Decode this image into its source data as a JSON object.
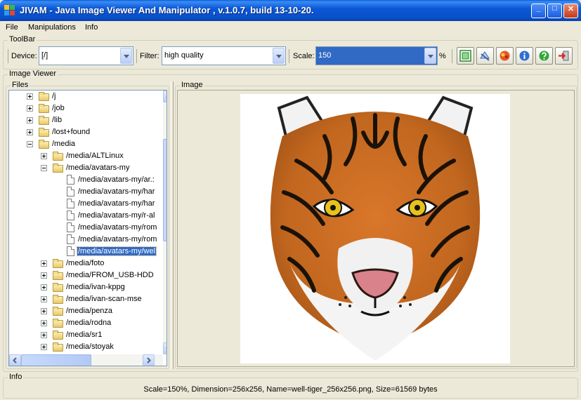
{
  "window": {
    "title": "JIVAM - Java Image Viewer And Manipulator , v.1.0.7, build 13-10-20.",
    "min_label": "_",
    "max_label": "□",
    "close_label": "✕"
  },
  "menu": {
    "items": [
      {
        "label": "File"
      },
      {
        "label": "Manipulations"
      },
      {
        "label": "Info"
      }
    ]
  },
  "toolbar": {
    "title": "ToolBar",
    "device_label": "Device:",
    "device_value": "[/]",
    "filter_label": "Filter:",
    "filter_value": "high quality",
    "scale_label": "Scale:",
    "scale_value": "150",
    "scale_unit": "%",
    "buttons": [
      {
        "icon": "fit-screen-icon"
      },
      {
        "icon": "rotate-icon"
      },
      {
        "icon": "palette-icon"
      },
      {
        "icon": "info-icon"
      },
      {
        "icon": "help-icon"
      },
      {
        "icon": "exit-icon"
      }
    ]
  },
  "viewer": {
    "title": "Image Viewer",
    "files_title": "Files",
    "image_title": "Image"
  },
  "tree": {
    "rows": [
      {
        "label": "/j",
        "type": "folder",
        "level": 0,
        "expander": "collapsed"
      },
      {
        "label": "/job",
        "type": "folder",
        "level": 0,
        "expander": "collapsed"
      },
      {
        "label": "/lib",
        "type": "folder",
        "level": 0,
        "expander": "collapsed"
      },
      {
        "label": "/lost+found",
        "type": "folder",
        "level": 0,
        "expander": "collapsed"
      },
      {
        "label": "/media",
        "type": "folder",
        "level": 0,
        "expander": "expanded"
      },
      {
        "label": "/media/ALTLinux",
        "type": "folder",
        "level": 1,
        "expander": "collapsed"
      },
      {
        "label": "/media/avatars-my",
        "type": "folder",
        "level": 1,
        "expander": "expanded"
      },
      {
        "label": "/media/avatars-my/ar.:",
        "type": "file",
        "level": 2
      },
      {
        "label": "/media/avatars-my/har",
        "type": "file",
        "level": 2
      },
      {
        "label": "/media/avatars-my/har",
        "type": "file",
        "level": 2
      },
      {
        "label": "/media/avatars-my/r-al",
        "type": "file",
        "level": 2
      },
      {
        "label": "/media/avatars-my/rom",
        "type": "file",
        "level": 2
      },
      {
        "label": "/media/avatars-my/rom",
        "type": "file",
        "level": 2
      },
      {
        "label": "/media/avatars-my/wel",
        "type": "file",
        "level": 2,
        "selected": true
      },
      {
        "label": "/media/foto",
        "type": "folder",
        "level": 1,
        "expander": "collapsed"
      },
      {
        "label": "/media/FROM_USB-HDD",
        "type": "folder",
        "level": 1,
        "expander": "collapsed"
      },
      {
        "label": "/media/ivan-kppg",
        "type": "folder",
        "level": 1,
        "expander": "collapsed"
      },
      {
        "label": "/media/ivan-scan-mse",
        "type": "folder",
        "level": 1,
        "expander": "collapsed"
      },
      {
        "label": "/media/penza",
        "type": "folder",
        "level": 1,
        "expander": "collapsed"
      },
      {
        "label": "/media/rodna",
        "type": "folder",
        "level": 1,
        "expander": "collapsed"
      },
      {
        "label": "/media/sr1",
        "type": "folder",
        "level": 1,
        "expander": "collapsed"
      },
      {
        "label": "/media/stoyak",
        "type": "folder",
        "level": 1,
        "expander": "collapsed"
      }
    ]
  },
  "image": {
    "subject": "tiger-face-image"
  },
  "info": {
    "title": "Info",
    "status": "Scale=150%, Dimension=256x256, Name=well-tiger_256x256.png, Size=61569 bytes"
  },
  "colors": {
    "titlebar": "#0a55d2",
    "selection": "#316ac5",
    "window_bg": "#ece9d8"
  }
}
